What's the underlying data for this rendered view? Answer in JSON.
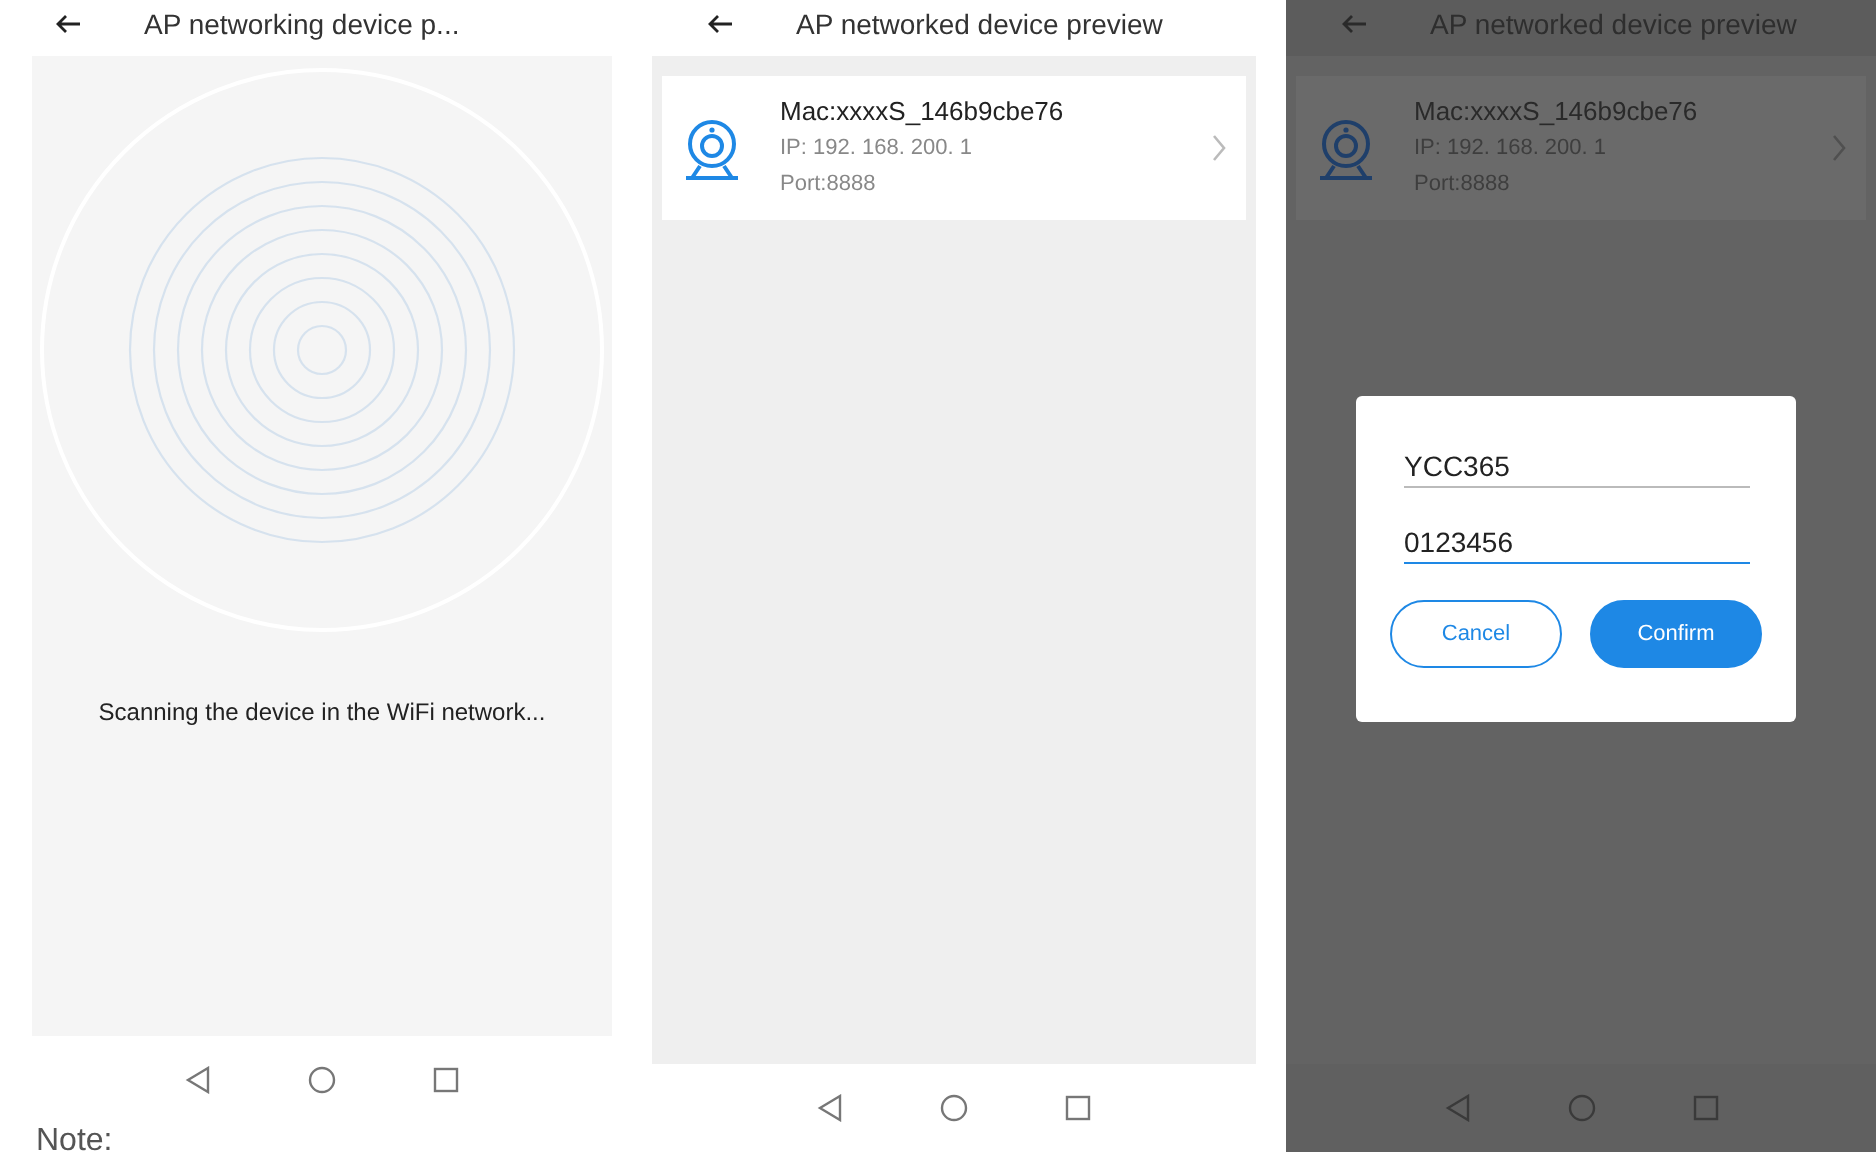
{
  "screens": [
    {
      "kind": "scanning",
      "title": "AP networking device p...",
      "status_text": "Scanning the device in the WiFi network..."
    },
    {
      "kind": "list",
      "title": "AP networked device preview",
      "devices": [
        {
          "mac": "Mac:xxxxS_146b9cbe76",
          "ip": "IP: 192. 168. 200. 1",
          "port": "Port:8888"
        }
      ]
    },
    {
      "kind": "dialog",
      "title": "AP networked device preview",
      "devices": [
        {
          "mac": "Mac:xxxxS_146b9cbe76",
          "ip": "IP: 192. 168. 200. 1",
          "port": "Port:8888"
        }
      ],
      "dialog": {
        "fields": [
          {
            "value": "YCC365",
            "focused": false
          },
          {
            "value": "0123456",
            "focused": true
          }
        ],
        "buttons": [
          {
            "label": "Cancel",
            "kind": "outline"
          },
          {
            "label": "Confirm",
            "kind": "filled"
          }
        ]
      }
    }
  ],
  "note": "Note:"
}
